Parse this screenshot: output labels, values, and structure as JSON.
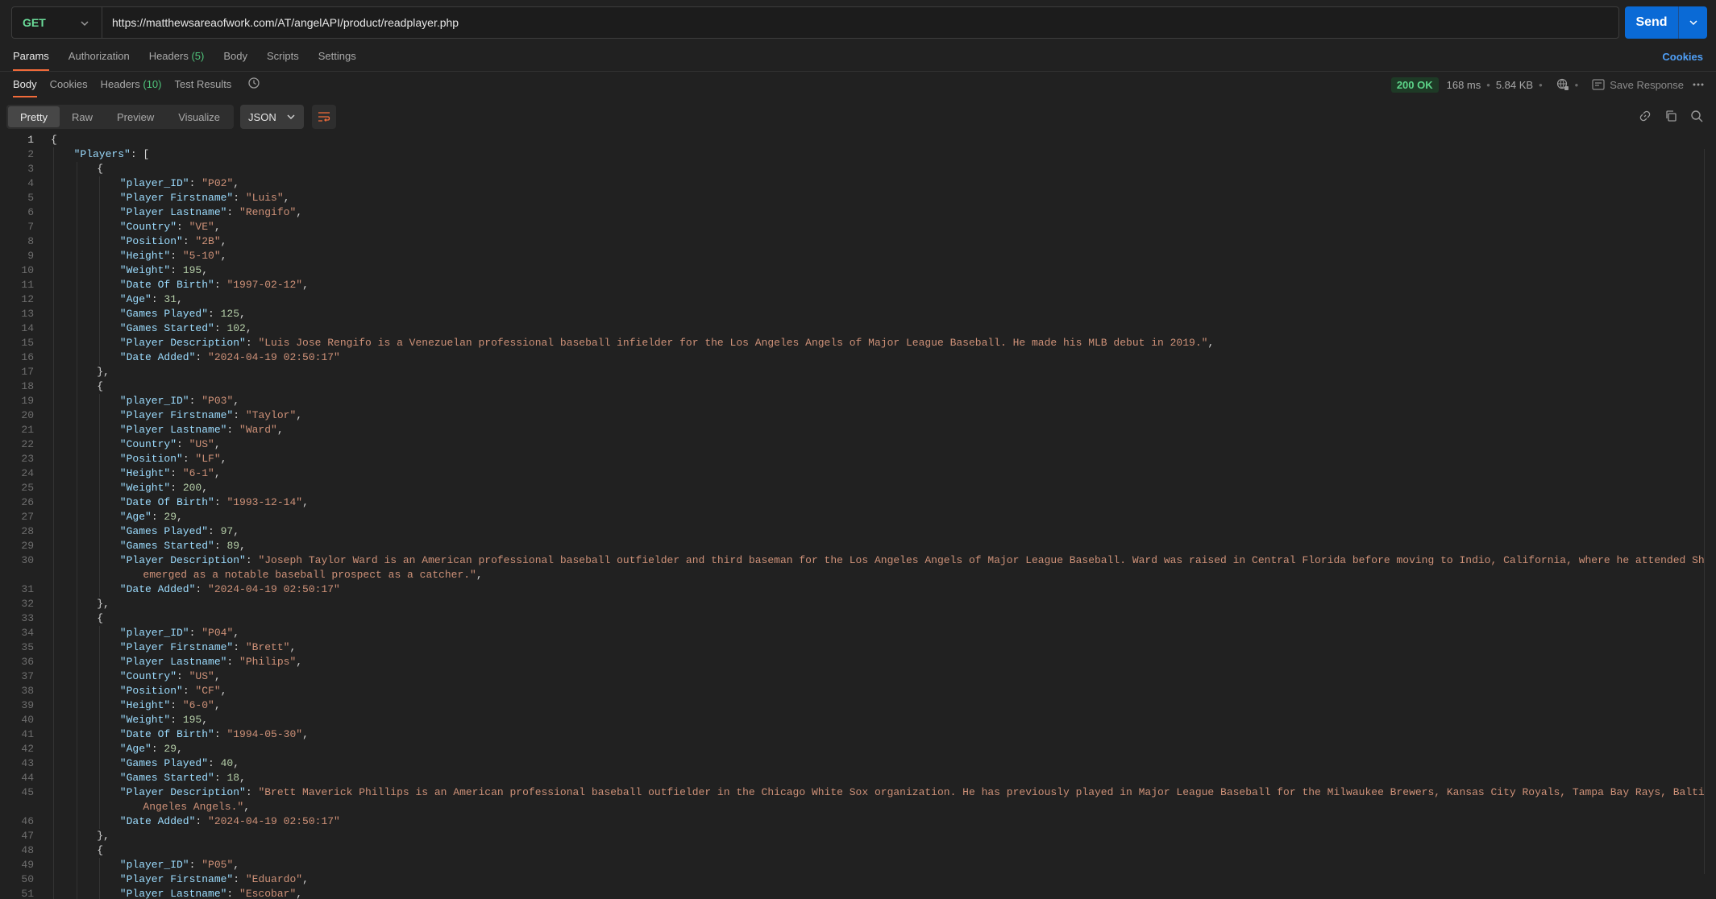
{
  "request": {
    "method": "GET",
    "url": "https://matthewsareaofwork.com/AT/angelAPI/product/readplayer.php",
    "send_label": "Send"
  },
  "request_tabs": {
    "params": "Params",
    "authorization": "Authorization",
    "headers": "Headers",
    "headers_count": "(5)",
    "body": "Body",
    "scripts": "Scripts",
    "settings": "Settings",
    "cookies": "Cookies"
  },
  "response_tabs": {
    "body": "Body",
    "cookies": "Cookies",
    "headers": "Headers",
    "headers_count": "(10)",
    "test_results": "Test Results"
  },
  "response_meta": {
    "status": "200 OK",
    "time": "168 ms",
    "size": "5.84 KB",
    "save_response": "Save Response"
  },
  "view": {
    "modes": [
      "Pretty",
      "Raw",
      "Preview",
      "Visualize"
    ],
    "active_mode": "Pretty",
    "format": "JSON"
  },
  "colors": {
    "accent": "#f26b3a",
    "send": "#0a6ad6",
    "method": "#6bdd9a",
    "status": "#5dd489",
    "key": "#9cdcfe",
    "string": "#ce9178",
    "number": "#b5cea8"
  },
  "code_lines": [
    {
      "n": "1",
      "i": 0,
      "t": [
        [
          "p",
          "{"
        ]
      ]
    },
    {
      "n": "2",
      "i": 1,
      "t": [
        [
          "k",
          "\"Players\""
        ],
        [
          "p",
          ": ["
        ]
      ]
    },
    {
      "n": "3",
      "i": 2,
      "t": [
        [
          "p",
          "{"
        ]
      ]
    },
    {
      "n": "4",
      "i": 3,
      "t": [
        [
          "k",
          "\"player_ID\""
        ],
        [
          "p",
          ": "
        ],
        [
          "s",
          "\"P02\""
        ],
        [
          "p",
          ","
        ]
      ]
    },
    {
      "n": "5",
      "i": 3,
      "t": [
        [
          "k",
          "\"Player Firstname\""
        ],
        [
          "p",
          ": "
        ],
        [
          "s",
          "\"Luis\""
        ],
        [
          "p",
          ","
        ]
      ]
    },
    {
      "n": "6",
      "i": 3,
      "t": [
        [
          "k",
          "\"Player Lastname\""
        ],
        [
          "p",
          ": "
        ],
        [
          "s",
          "\"Rengifo\""
        ],
        [
          "p",
          ","
        ]
      ]
    },
    {
      "n": "7",
      "i": 3,
      "t": [
        [
          "k",
          "\"Country\""
        ],
        [
          "p",
          ": "
        ],
        [
          "s",
          "\"VE\""
        ],
        [
          "p",
          ","
        ]
      ]
    },
    {
      "n": "8",
      "i": 3,
      "t": [
        [
          "k",
          "\"Position\""
        ],
        [
          "p",
          ": "
        ],
        [
          "s",
          "\"2B\""
        ],
        [
          "p",
          ","
        ]
      ]
    },
    {
      "n": "9",
      "i": 3,
      "t": [
        [
          "k",
          "\"Height\""
        ],
        [
          "p",
          ": "
        ],
        [
          "s",
          "\"5-10\""
        ],
        [
          "p",
          ","
        ]
      ]
    },
    {
      "n": "10",
      "i": 3,
      "t": [
        [
          "k",
          "\"Weight\""
        ],
        [
          "p",
          ": "
        ],
        [
          "n",
          "195"
        ],
        [
          "p",
          ","
        ]
      ]
    },
    {
      "n": "11",
      "i": 3,
      "t": [
        [
          "k",
          "\"Date Of Birth\""
        ],
        [
          "p",
          ": "
        ],
        [
          "s",
          "\"1997-02-12\""
        ],
        [
          "p",
          ","
        ]
      ]
    },
    {
      "n": "12",
      "i": 3,
      "t": [
        [
          "k",
          "\"Age\""
        ],
        [
          "p",
          ": "
        ],
        [
          "n",
          "31"
        ],
        [
          "p",
          ","
        ]
      ]
    },
    {
      "n": "13",
      "i": 3,
      "t": [
        [
          "k",
          "\"Games Played\""
        ],
        [
          "p",
          ": "
        ],
        [
          "n",
          "125"
        ],
        [
          "p",
          ","
        ]
      ]
    },
    {
      "n": "14",
      "i": 3,
      "t": [
        [
          "k",
          "\"Games Started\""
        ],
        [
          "p",
          ": "
        ],
        [
          "n",
          "102"
        ],
        [
          "p",
          ","
        ]
      ]
    },
    {
      "n": "15",
      "i": 3,
      "t": [
        [
          "k",
          "\"Player Description\""
        ],
        [
          "p",
          ": "
        ],
        [
          "s",
          "\"Luis Jose Rengifo is a Venezuelan professional baseball infielder for the Los Angeles Angels of Major League Baseball. He made his MLB debut in 2019.\""
        ],
        [
          "p",
          ","
        ]
      ]
    },
    {
      "n": "16",
      "i": 3,
      "t": [
        [
          "k",
          "\"Date Added\""
        ],
        [
          "p",
          ": "
        ],
        [
          "s",
          "\"2024-04-19 02:50:17\""
        ]
      ]
    },
    {
      "n": "17",
      "i": 2,
      "t": [
        [
          "p",
          "},"
        ]
      ]
    },
    {
      "n": "18",
      "i": 2,
      "t": [
        [
          "p",
          "{"
        ]
      ]
    },
    {
      "n": "19",
      "i": 3,
      "t": [
        [
          "k",
          "\"player_ID\""
        ],
        [
          "p",
          ": "
        ],
        [
          "s",
          "\"P03\""
        ],
        [
          "p",
          ","
        ]
      ]
    },
    {
      "n": "20",
      "i": 3,
      "t": [
        [
          "k",
          "\"Player Firstname\""
        ],
        [
          "p",
          ": "
        ],
        [
          "s",
          "\"Taylor\""
        ],
        [
          "p",
          ","
        ]
      ]
    },
    {
      "n": "21",
      "i": 3,
      "t": [
        [
          "k",
          "\"Player Lastname\""
        ],
        [
          "p",
          ": "
        ],
        [
          "s",
          "\"Ward\""
        ],
        [
          "p",
          ","
        ]
      ]
    },
    {
      "n": "22",
      "i": 3,
      "t": [
        [
          "k",
          "\"Country\""
        ],
        [
          "p",
          ": "
        ],
        [
          "s",
          "\"US\""
        ],
        [
          "p",
          ","
        ]
      ]
    },
    {
      "n": "23",
      "i": 3,
      "t": [
        [
          "k",
          "\"Position\""
        ],
        [
          "p",
          ": "
        ],
        [
          "s",
          "\"LF\""
        ],
        [
          "p",
          ","
        ]
      ]
    },
    {
      "n": "24",
      "i": 3,
      "t": [
        [
          "k",
          "\"Height\""
        ],
        [
          "p",
          ": "
        ],
        [
          "s",
          "\"6-1\""
        ],
        [
          "p",
          ","
        ]
      ]
    },
    {
      "n": "25",
      "i": 3,
      "t": [
        [
          "k",
          "\"Weight\""
        ],
        [
          "p",
          ": "
        ],
        [
          "n",
          "200"
        ],
        [
          "p",
          ","
        ]
      ]
    },
    {
      "n": "26",
      "i": 3,
      "t": [
        [
          "k",
          "\"Date Of Birth\""
        ],
        [
          "p",
          ": "
        ],
        [
          "s",
          "\"1993-12-14\""
        ],
        [
          "p",
          ","
        ]
      ]
    },
    {
      "n": "27",
      "i": 3,
      "t": [
        [
          "k",
          "\"Age\""
        ],
        [
          "p",
          ": "
        ],
        [
          "n",
          "29"
        ],
        [
          "p",
          ","
        ]
      ]
    },
    {
      "n": "28",
      "i": 3,
      "t": [
        [
          "k",
          "\"Games Played\""
        ],
        [
          "p",
          ": "
        ],
        [
          "n",
          "97"
        ],
        [
          "p",
          ","
        ]
      ]
    },
    {
      "n": "29",
      "i": 3,
      "t": [
        [
          "k",
          "\"Games Started\""
        ],
        [
          "p",
          ": "
        ],
        [
          "n",
          "89"
        ],
        [
          "p",
          ","
        ]
      ]
    },
    {
      "n": "30",
      "i": 3,
      "t": [
        [
          "k",
          "\"Player Description\""
        ],
        [
          "p",
          ": "
        ],
        [
          "s",
          "\"Joseph Taylor Ward is an American professional baseball outfielder and third baseman for the Los Angeles Angels of Major League Baseball. Ward was raised in Central Florida before moving to Indio, California, where he attended Shadow Hills High School"
        ]
      ]
    },
    {
      "n": "",
      "i": 4,
      "t": [
        [
          "s",
          "emerged as a notable baseball prospect as a catcher.\""
        ],
        [
          "p",
          ","
        ]
      ]
    },
    {
      "n": "31",
      "i": 3,
      "t": [
        [
          "k",
          "\"Date Added\""
        ],
        [
          "p",
          ": "
        ],
        [
          "s",
          "\"2024-04-19 02:50:17\""
        ]
      ]
    },
    {
      "n": "32",
      "i": 2,
      "t": [
        [
          "p",
          "},"
        ]
      ]
    },
    {
      "n": "33",
      "i": 2,
      "t": [
        [
          "p",
          "{"
        ]
      ]
    },
    {
      "n": "34",
      "i": 3,
      "t": [
        [
          "k",
          "\"player_ID\""
        ],
        [
          "p",
          ": "
        ],
        [
          "s",
          "\"P04\""
        ],
        [
          "p",
          ","
        ]
      ]
    },
    {
      "n": "35",
      "i": 3,
      "t": [
        [
          "k",
          "\"Player Firstname\""
        ],
        [
          "p",
          ": "
        ],
        [
          "s",
          "\"Brett\""
        ],
        [
          "p",
          ","
        ]
      ]
    },
    {
      "n": "36",
      "i": 3,
      "t": [
        [
          "k",
          "\"Player Lastname\""
        ],
        [
          "p",
          ": "
        ],
        [
          "s",
          "\"Philips\""
        ],
        [
          "p",
          ","
        ]
      ]
    },
    {
      "n": "37",
      "i": 3,
      "t": [
        [
          "k",
          "\"Country\""
        ],
        [
          "p",
          ": "
        ],
        [
          "s",
          "\"US\""
        ],
        [
          "p",
          ","
        ]
      ]
    },
    {
      "n": "38",
      "i": 3,
      "t": [
        [
          "k",
          "\"Position\""
        ],
        [
          "p",
          ": "
        ],
        [
          "s",
          "\"CF\""
        ],
        [
          "p",
          ","
        ]
      ]
    },
    {
      "n": "39",
      "i": 3,
      "t": [
        [
          "k",
          "\"Height\""
        ],
        [
          "p",
          ": "
        ],
        [
          "s",
          "\"6-0\""
        ],
        [
          "p",
          ","
        ]
      ]
    },
    {
      "n": "40",
      "i": 3,
      "t": [
        [
          "k",
          "\"Weight\""
        ],
        [
          "p",
          ": "
        ],
        [
          "n",
          "195"
        ],
        [
          "p",
          ","
        ]
      ]
    },
    {
      "n": "41",
      "i": 3,
      "t": [
        [
          "k",
          "\"Date Of Birth\""
        ],
        [
          "p",
          ": "
        ],
        [
          "s",
          "\"1994-05-30\""
        ],
        [
          "p",
          ","
        ]
      ]
    },
    {
      "n": "42",
      "i": 3,
      "t": [
        [
          "k",
          "\"Age\""
        ],
        [
          "p",
          ": "
        ],
        [
          "n",
          "29"
        ],
        [
          "p",
          ","
        ]
      ]
    },
    {
      "n": "43",
      "i": 3,
      "t": [
        [
          "k",
          "\"Games Played\""
        ],
        [
          "p",
          ": "
        ],
        [
          "n",
          "40"
        ],
        [
          "p",
          ","
        ]
      ]
    },
    {
      "n": "44",
      "i": 3,
      "t": [
        [
          "k",
          "\"Games Started\""
        ],
        [
          "p",
          ": "
        ],
        [
          "n",
          "18"
        ],
        [
          "p",
          ","
        ]
      ]
    },
    {
      "n": "45",
      "i": 3,
      "t": [
        [
          "k",
          "\"Player Description\""
        ],
        [
          "p",
          ": "
        ],
        [
          "s",
          "\"Brett Maverick Phillips is an American professional baseball outfielder in the Chicago White Sox organization. He has previously played in Major League Baseball for the Milwaukee Brewers, Kansas City Royals, Tampa Bay Rays, Baltimore Orioles, and Los"
        ]
      ]
    },
    {
      "n": "",
      "i": 4,
      "t": [
        [
          "s",
          "Angeles Angels.\""
        ],
        [
          "p",
          ","
        ]
      ]
    },
    {
      "n": "46",
      "i": 3,
      "t": [
        [
          "k",
          "\"Date Added\""
        ],
        [
          "p",
          ": "
        ],
        [
          "s",
          "\"2024-04-19 02:50:17\""
        ]
      ]
    },
    {
      "n": "47",
      "i": 2,
      "t": [
        [
          "p",
          "},"
        ]
      ]
    },
    {
      "n": "48",
      "i": 2,
      "t": [
        [
          "p",
          "{"
        ]
      ]
    },
    {
      "n": "49",
      "i": 3,
      "t": [
        [
          "k",
          "\"player_ID\""
        ],
        [
          "p",
          ": "
        ],
        [
          "s",
          "\"P05\""
        ],
        [
          "p",
          ","
        ]
      ]
    },
    {
      "n": "50",
      "i": 3,
      "t": [
        [
          "k",
          "\"Player Firstname\""
        ],
        [
          "p",
          ": "
        ],
        [
          "s",
          "\"Eduardo\""
        ],
        [
          "p",
          ","
        ]
      ]
    },
    {
      "n": "51",
      "i": 3,
      "t": [
        [
          "k",
          "\"Player Lastname\""
        ],
        [
          "p",
          ": "
        ],
        [
          "s",
          "\"Escobar\""
        ],
        [
          "p",
          ","
        ]
      ]
    }
  ]
}
